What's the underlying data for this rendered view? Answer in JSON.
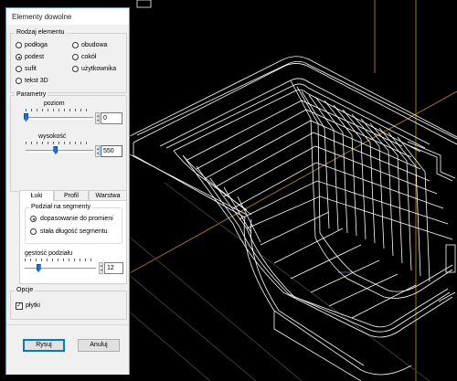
{
  "dialog": {
    "title": "Elementy dowolne"
  },
  "element_type": {
    "legend": "Rodzaj elementu",
    "options": [
      "podłoga",
      "obudowa",
      "podest",
      "cokół",
      "sufit",
      "użytkownika",
      "tekst 3D"
    ],
    "selected": "podest"
  },
  "params": {
    "legend": "Parametry",
    "poziom": {
      "label": "poziom",
      "value": "0",
      "slider_fraction": 0.0
    },
    "wysokosc": {
      "label": "wysokość",
      "value": "550",
      "slider_fraction": 0.47
    }
  },
  "tabs": {
    "items": [
      "Łuki",
      "Profil",
      "Warstwa"
    ],
    "active": "Łuki"
  },
  "segments": {
    "legend": "Podział na segmenty",
    "options": [
      "dopasowanie do promieni",
      "stała długość segmentu"
    ],
    "selected": "dopasowanie do promieni"
  },
  "density": {
    "label": "gęstość podziału",
    "value": "12",
    "slider_fraction": 0.2
  },
  "options": {
    "legend": "Opcje",
    "checkbox_label": "płytki",
    "checked": true,
    "check_glyph": "✓"
  },
  "buttons": {
    "ok": "Rysuj",
    "cancel": "Anuluj"
  },
  "colors": {
    "viewport_bg": "#000000",
    "wireframe": "#ffffff",
    "guide_line": "#d4a531",
    "accent": "#1e6fd9"
  }
}
